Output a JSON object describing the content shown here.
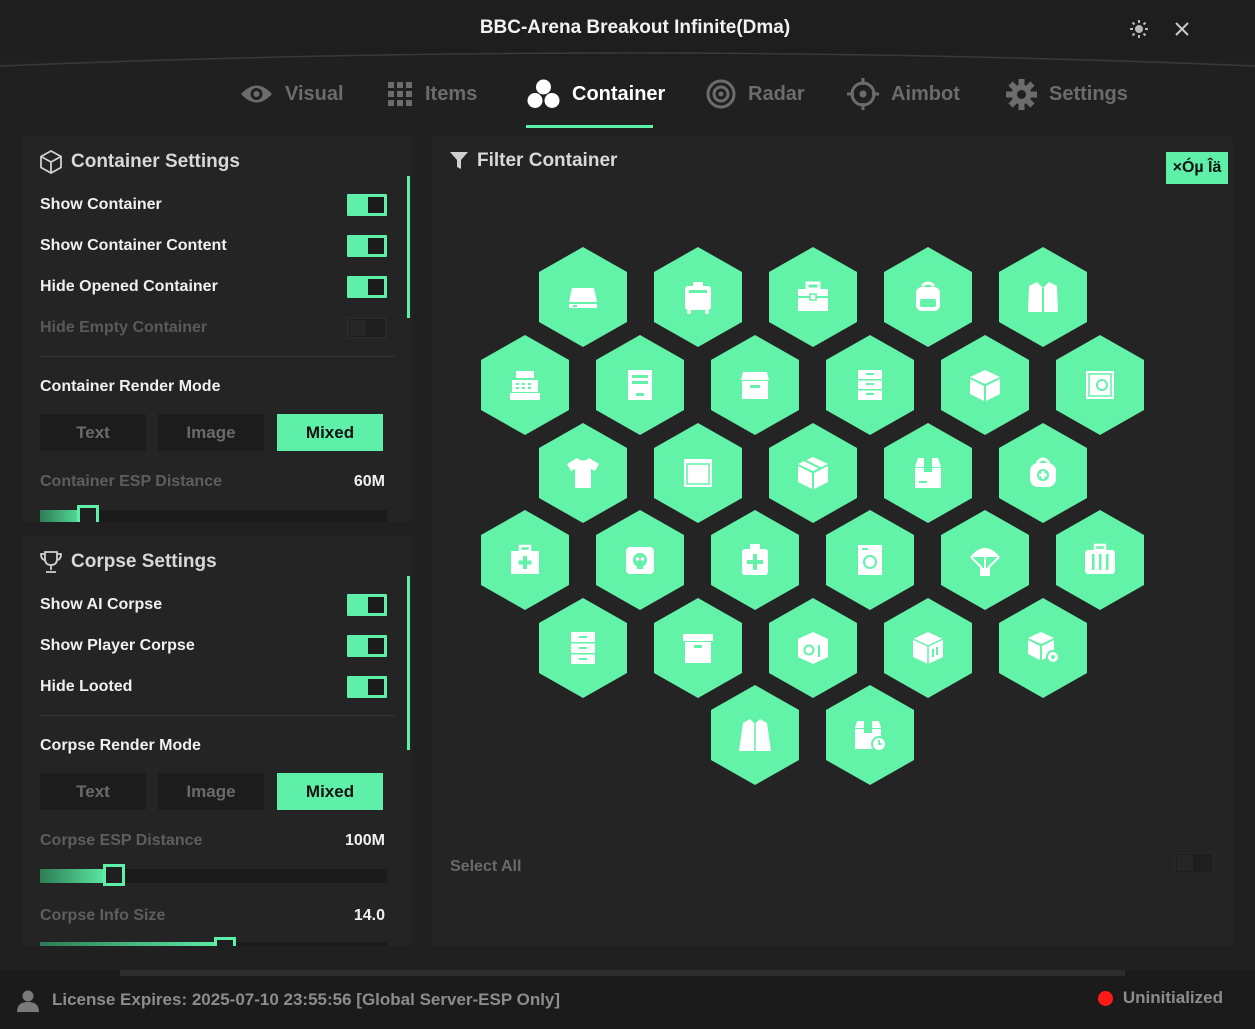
{
  "window": {
    "title": "BBC-Arena Breakout Infinite(Dma)"
  },
  "tabs": [
    {
      "label": "Visual",
      "icon": "eye-icon",
      "active": false
    },
    {
      "label": "Items",
      "icon": "grid-icon",
      "active": false
    },
    {
      "label": "Container",
      "icon": "cubes-icon",
      "active": true
    },
    {
      "label": "Radar",
      "icon": "radar-icon",
      "active": false
    },
    {
      "label": "Aimbot",
      "icon": "crosshair-icon",
      "active": false
    },
    {
      "label": "Settings",
      "icon": "gear-icon",
      "active": false
    }
  ],
  "container_settings": {
    "title": "Container Settings",
    "toggles": [
      {
        "label": "Show Container",
        "on": true
      },
      {
        "label": "Show Container Content",
        "on": true
      },
      {
        "label": "Hide Opened Container",
        "on": true
      },
      {
        "label": "Hide Empty Container",
        "on": false
      }
    ],
    "render_mode_label": "Container Render Mode",
    "render_modes": [
      "Text",
      "Image",
      "Mixed"
    ],
    "render_mode_selected": "Mixed",
    "esp_distance": {
      "label": "Container ESP Distance",
      "value": "60M",
      "fraction": 0.14
    }
  },
  "corpse_settings": {
    "title": "Corpse Settings",
    "toggles": [
      {
        "label": "Show AI Corpse",
        "on": true
      },
      {
        "label": "Show Player Corpse",
        "on": true
      },
      {
        "label": "Hide Looted",
        "on": true
      }
    ],
    "render_mode_label": "Corpse Render Mode",
    "render_modes": [
      "Text",
      "Image",
      "Mixed"
    ],
    "render_mode_selected": "Mixed",
    "esp_distance": {
      "label": "Corpse ESP Distance",
      "value": "100M",
      "fraction": 0.2
    },
    "info_size": {
      "label": "Corpse Info Size",
      "value": "14.0",
      "fraction": 0.53
    }
  },
  "filter": {
    "title": "Filter Container",
    "badge": "×Óµ Îä",
    "select_all_label": "Select All",
    "select_all_on": false,
    "containers": [
      "drive-icon",
      "suitcase-icon",
      "toolbox-icon",
      "backpack-icon",
      "jacket-icon",
      "cash-register-icon",
      "file-box-icon",
      "storage-bin-icon",
      "drawer-cabinet-icon",
      "cube-icon",
      "safe-icon",
      "shirt-icon",
      "crate-icon",
      "package-icon",
      "open-box-icon",
      "medical-bag-icon",
      "first-aid-kit-icon",
      "skull-box-icon",
      "medkit-icon",
      "cooler-icon",
      "airdrop-icon",
      "luggage-icon",
      "dresser-icon",
      "archive-box-icon",
      "weapon-case-icon",
      "wooden-crate-icon",
      "supply-box-icon",
      "coat-icon",
      "timed-box-icon"
    ]
  },
  "status": {
    "license": "License Expires: 2025-07-10  23:55:56 [Global Server-ESP Only]",
    "state": "Uninitialized"
  }
}
